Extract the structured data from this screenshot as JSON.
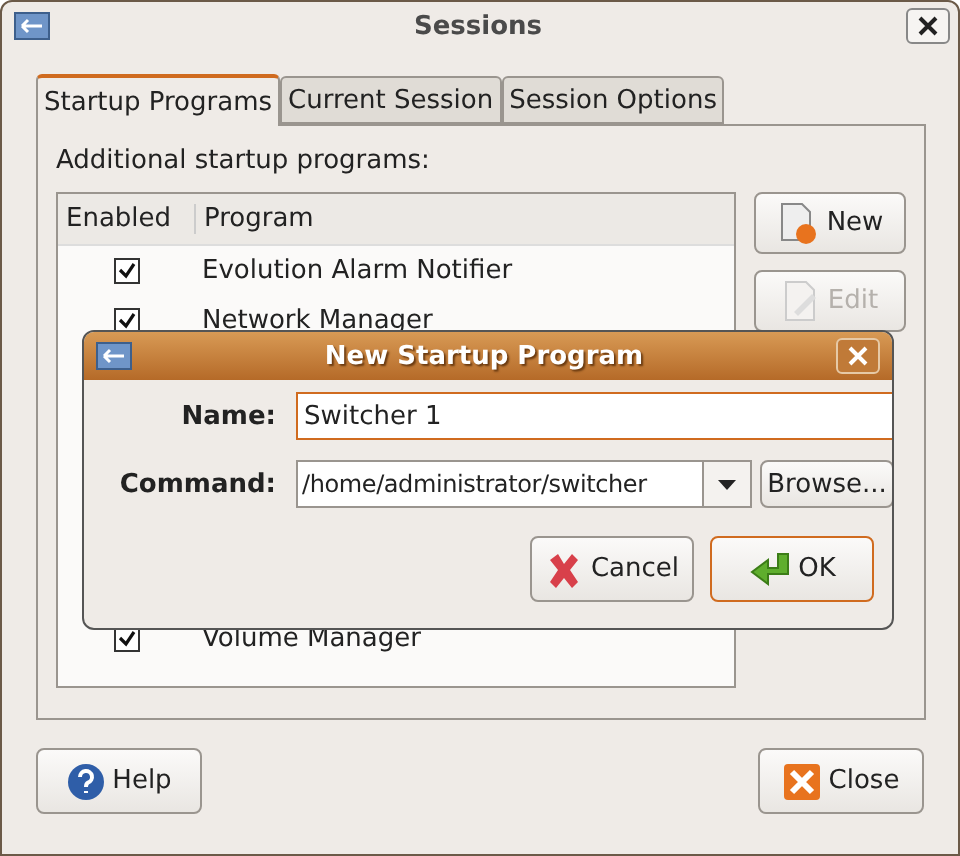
{
  "window": {
    "title": "Sessions"
  },
  "tabs": [
    {
      "label": "Startup Programs",
      "selected": true
    },
    {
      "label": "Current Session",
      "selected": false
    },
    {
      "label": "Session Options",
      "selected": false
    }
  ],
  "list_label": "Additional startup programs:",
  "table": {
    "columns": [
      "Enabled",
      "Program"
    ],
    "rows": [
      {
        "enabled": true,
        "program": "Evolution Alarm Notifier"
      },
      {
        "enabled": true,
        "program": "Network Manager"
      },
      {
        "enabled": true,
        "program": "Volume Manager"
      }
    ]
  },
  "side_buttons": [
    {
      "label": "New",
      "disabled": false,
      "kind": "new"
    },
    {
      "label": "Edit",
      "disabled": true,
      "kind": "edit"
    }
  ],
  "footer_buttons": [
    {
      "label": "Help",
      "kind": "help"
    },
    {
      "label": "Close",
      "kind": "close"
    }
  ],
  "dialog": {
    "title": "New Startup Program",
    "name_label": "Name:",
    "name_value": "Switcher 1",
    "command_label": "Command:",
    "command_value": "/home/administrator/switcher",
    "browse": "Browse...",
    "buttons": [
      {
        "label": "Cancel",
        "kind": "cancel",
        "default": false
      },
      {
        "label": "OK",
        "kind": "ok",
        "default": true
      }
    ]
  }
}
